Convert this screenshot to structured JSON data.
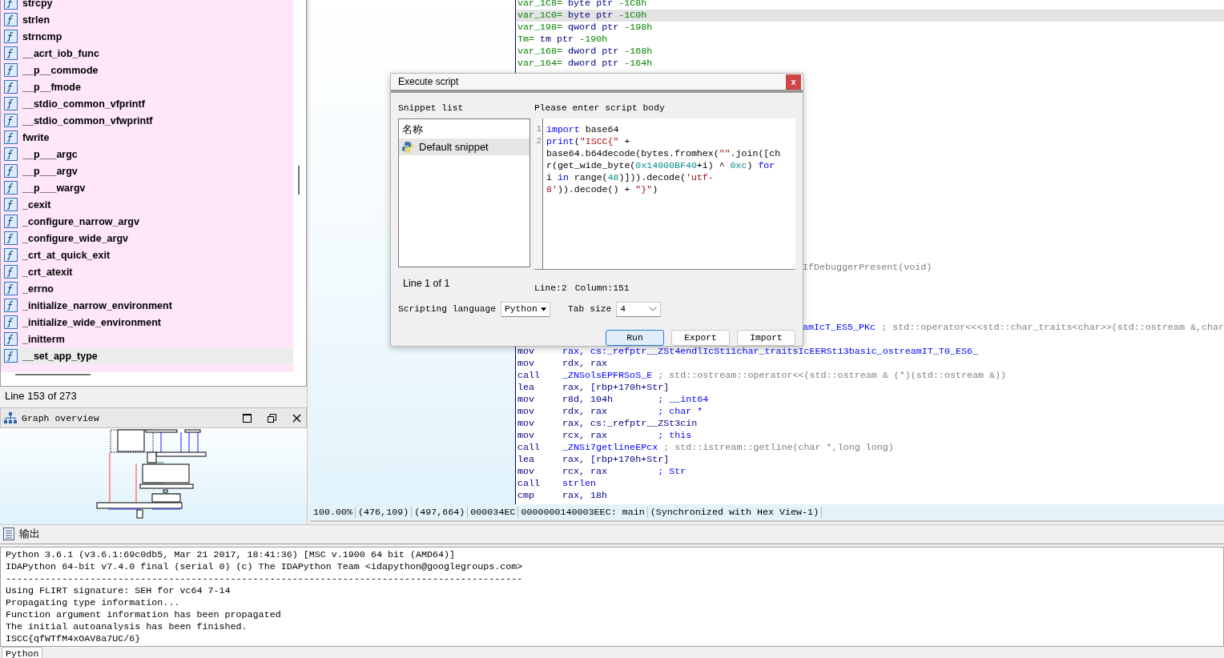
{
  "function_list": {
    "items": [
      {
        "name": "strcpy",
        "selected": false
      },
      {
        "name": "strlen",
        "selected": false
      },
      {
        "name": "strncmp",
        "selected": false
      },
      {
        "name": "__acrt_iob_func",
        "selected": false
      },
      {
        "name": "__p__commode",
        "selected": false
      },
      {
        "name": "__p__fmode",
        "selected": false
      },
      {
        "name": "__stdio_common_vfprintf",
        "selected": false
      },
      {
        "name": "__stdio_common_vfwprintf",
        "selected": false
      },
      {
        "name": "fwrite",
        "selected": false
      },
      {
        "name": "__p___argc",
        "selected": false
      },
      {
        "name": "__p___argv",
        "selected": false
      },
      {
        "name": "__p___wargv",
        "selected": false
      },
      {
        "name": "_cexit",
        "selected": false
      },
      {
        "name": "_configure_narrow_argv",
        "selected": false
      },
      {
        "name": "_configure_wide_argv",
        "selected": false
      },
      {
        "name": "_crt_at_quick_exit",
        "selected": false
      },
      {
        "name": "_crt_atexit",
        "selected": false
      },
      {
        "name": "_errno",
        "selected": false
      },
      {
        "name": "_initialize_narrow_environment",
        "selected": false
      },
      {
        "name": "_initialize_wide_environment",
        "selected": false
      },
      {
        "name": "_initterm",
        "selected": false
      },
      {
        "name": "__set_app_type",
        "selected": true
      }
    ],
    "status": "Line 153 of 273"
  },
  "graph_overview": {
    "title": "Graph overview"
  },
  "disassembly": {
    "lines": [
      {
        "kind": "decl",
        "name": "var_1C8=",
        "type": "byte ptr",
        "offset": "-1C8h",
        "selected": false
      },
      {
        "kind": "decl",
        "name": "var_1C0=",
        "type": "byte ptr",
        "offset": "-1C0h",
        "selected": true
      },
      {
        "kind": "decl",
        "name": "var_198=",
        "type": "qword ptr",
        "offset": "-198h",
        "selected": false
      },
      {
        "kind": "decl",
        "name": "Tm=",
        "type": "tm ptr",
        "offset": "-190h",
        "selected": false
      },
      {
        "kind": "decl",
        "name": "var_168=",
        "type": "dword ptr",
        "offset": "-168h",
        "selected": false
      },
      {
        "kind": "decl",
        "name": "var_164=",
        "type": "dword ptr",
        "offset": "-164h",
        "selected": false
      },
      {
        "kind": "hidden",
        "selected": false
      },
      {
        "kind": "hidden",
        "selected": false
      },
      {
        "kind": "hidden",
        "selected": false
      },
      {
        "kind": "hidden",
        "selected": false
      },
      {
        "kind": "hidden",
        "selected": false
      },
      {
        "kind": "hidden",
        "selected": false
      },
      {
        "kind": "hidden",
        "selected": false
      },
      {
        "kind": "hidden",
        "selected": false
      },
      {
        "kind": "hidden",
        "selected": false
      },
      {
        "kind": "hidden",
        "selected": false
      },
      {
        "kind": "hidden",
        "selected": false
      },
      {
        "kind": "hidden",
        "selected": false
      },
      {
        "kind": "hidden",
        "selected": false
      },
      {
        "kind": "hidden",
        "selected": false
      },
      {
        "kind": "hidden",
        "selected": false
      },
      {
        "kind": "hidden",
        "selected": false
      },
      {
        "kind": "fragment",
        "comment": {
          "text": "IfDebuggerPresent(void)",
          "kind": "demangled"
        },
        "selected": false
      },
      {
        "kind": "hidden",
        "selected": false
      },
      {
        "kind": "hidden",
        "selected": false
      },
      {
        "kind": "hidden",
        "selected": false
      },
      {
        "kind": "hidden",
        "selected": false
      },
      {
        "kind": "fragment",
        "operands": {
          "text": "amIcT_ES5_PKc",
          "kind": "name"
        },
        "comment": {
          "text": "; std::operator<<<std::char_traits<char>>(std::ostream &,char",
          "kind": "demangled"
        },
        "selected": false
      },
      {
        "kind": "hidden",
        "selected": false
      },
      {
        "kind": "ins",
        "mnemonic": "mov",
        "operands": {
          "text": "rax, cs:_refptr__ZSt4endlIcSt11char_traitsIcEERSt13basic_ostreamIT_T0_ES6_",
          "kind": "name"
        },
        "selected": false
      },
      {
        "kind": "ins",
        "mnemonic": "mov",
        "operands": {
          "text": "rdx, rax",
          "kind": "register"
        },
        "selected": false
      },
      {
        "kind": "ins",
        "mnemonic": "call",
        "operands": {
          "text": "_ZNSolsEPFRSoS_E",
          "kind": "name"
        },
        "comment": {
          "text": "; std::ostream::operator<<(std::ostream & (*)(std::ostream &))",
          "kind": "demangled"
        },
        "selected": false
      },
      {
        "kind": "ins",
        "mnemonic": "lea",
        "operands": {
          "text": "rax, [rbp+170h+Str]",
          "kind": "register"
        },
        "selected": false
      },
      {
        "kind": "ins",
        "mnemonic": "mov",
        "operands": {
          "text": "r8d, 104h       ",
          "kind": "register"
        },
        "comment": {
          "text": "; __int64",
          "kind": "type"
        },
        "selected": false
      },
      {
        "kind": "ins",
        "mnemonic": "mov",
        "operands": {
          "text": "rdx, rax        ",
          "kind": "register"
        },
        "comment": {
          "text": "; char *",
          "kind": "type"
        },
        "selected": false
      },
      {
        "kind": "ins",
        "mnemonic": "mov",
        "operands": {
          "text": "rax, cs:_refptr__ZSt3cin",
          "kind": "register"
        },
        "selected": false
      },
      {
        "kind": "ins",
        "mnemonic": "mov",
        "operands": {
          "text": "rcx, rax        ",
          "kind": "register"
        },
        "comment": {
          "text": "; this",
          "kind": "type"
        },
        "selected": false
      },
      {
        "kind": "ins",
        "mnemonic": "call",
        "operands": {
          "text": "_ZNSi7getlineEPcx",
          "kind": "name"
        },
        "comment": {
          "text": "; std::istream::getline(char *,long long)",
          "kind": "demangled"
        },
        "selected": false
      },
      {
        "kind": "ins",
        "mnemonic": "lea",
        "operands": {
          "text": "rax, [rbp+170h+Str]",
          "kind": "register"
        },
        "selected": false
      },
      {
        "kind": "ins",
        "mnemonic": "mov",
        "operands": {
          "text": "rcx, rax        ",
          "kind": "register"
        },
        "comment": {
          "text": "; Str",
          "kind": "type"
        },
        "selected": false
      },
      {
        "kind": "ins",
        "mnemonic": "call",
        "operands": {
          "text": "strlen",
          "kind": "name"
        },
        "selected": false
      },
      {
        "kind": "ins",
        "mnemonic": "cmp",
        "operands": {
          "text": "rax, 18h",
          "kind": "register"
        },
        "selected": false
      }
    ]
  },
  "status_bar": {
    "cells": [
      "100.00%",
      "(476,109)",
      "(497,664)",
      "000034EC",
      "0000000140003EEC: main",
      "(Synchronized with Hex View-1)"
    ]
  },
  "output": {
    "title": "输出",
    "lines": [
      "Python 3.6.1 (v3.6.1:69c0db5, Mar 21 2017, 18:41:36) [MSC v.1900 64 bit (AMD64)]",
      "IDAPython 64-bit v7.4.0 final (serial 0) (c) The IDAPython Team <idapython@googlegroups.com>",
      "--------------------------------------------------------------------------------------------",
      "Using FLIRT signature: SEH for vc64 7-14",
      "Propagating type information...",
      "Function argument information has been propagated",
      "The initial autoanalysis has been finished.",
      "ISCC{qfWTfM4xOAV8a7UC/6}"
    ],
    "tab": "Python"
  },
  "dialog": {
    "title": "Execute script",
    "close": "x",
    "snippet_label": "Snippet list",
    "snippet_header": "名称",
    "snippets": [
      {
        "name": "Default snippet",
        "selected": true
      }
    ],
    "snippet_status": "Line 1 of 1",
    "body_label": "Please enter script body",
    "script": [
      {
        "number": "1",
        "tokens": [
          {
            "text": "import",
            "kind": "keyword"
          },
          {
            "text": " base64",
            "kind": "plain"
          }
        ]
      },
      {
        "number": "2",
        "tokens": [
          {
            "text": "print",
            "kind": "keyword"
          },
          {
            "text": "(",
            "kind": "plain"
          },
          {
            "text": "\"ISCC{\"",
            "kind": "string"
          },
          {
            "text": " + base64.b64decode(bytes.fromhex(",
            "kind": "plain"
          },
          {
            "text": "\"\"",
            "kind": "string"
          },
          {
            "text": ".join([chr(get_wide_byte(",
            "kind": "plain"
          },
          {
            "text": "0x14000BF40",
            "kind": "number"
          },
          {
            "text": "+i) ^ ",
            "kind": "plain"
          },
          {
            "text": "0xc",
            "kind": "number"
          },
          {
            "text": ") ",
            "kind": "plain"
          },
          {
            "text": "for",
            "kind": "keyword"
          },
          {
            "text": " i ",
            "kind": "plain"
          },
          {
            "text": "in",
            "kind": "keyword"
          },
          {
            "text": " range(",
            "kind": "plain"
          },
          {
            "text": "48",
            "kind": "number"
          },
          {
            "text": ")])).decode(",
            "kind": "plain"
          },
          {
            "text": "'utf-8'",
            "kind": "string"
          },
          {
            "text": ")).decode() + ",
            "kind": "plain"
          },
          {
            "text": "\"}\"",
            "kind": "string"
          },
          {
            "text": ")",
            "kind": "plain"
          }
        ]
      }
    ],
    "cursor_line": "Line:2",
    "cursor_column": "Column:151",
    "language_label": "Scripting language",
    "language": "Python",
    "tab_size_label": "Tab size",
    "tab_size": "4",
    "buttons": [
      {
        "label": "Run",
        "selected": true
      },
      {
        "label": "Export",
        "selected": false
      },
      {
        "label": "Import",
        "selected": false
      }
    ]
  }
}
